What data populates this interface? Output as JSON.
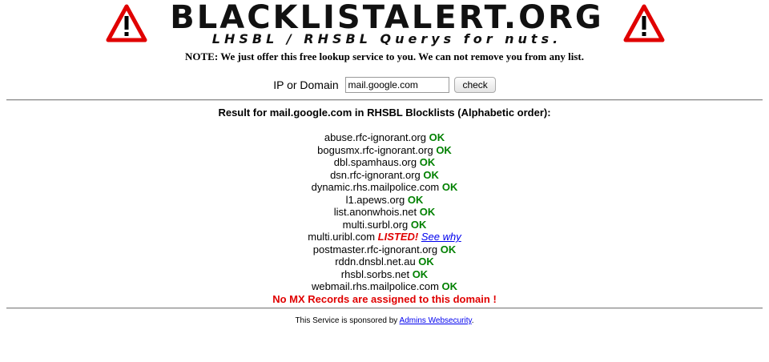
{
  "header": {
    "title": "BLACKLISTALERT.ORG",
    "subtitle": "LHSBL / RHSBL Querys for nuts.",
    "warning_icon": "warning-triangle-icon"
  },
  "note": "NOTE: We just offer this free lookup service to you. We can not remove you from any list.",
  "form": {
    "label": "IP or Domain",
    "input_value": "mail.google.com",
    "button_label": "check"
  },
  "result_title": "Result for mail.google.com in RHSBL Blocklists (Alphabetic order):",
  "results": [
    {
      "list": "abuse.rfc-ignorant.org",
      "status": "OK"
    },
    {
      "list": "bogusmx.rfc-ignorant.org",
      "status": "OK"
    },
    {
      "list": "dbl.spamhaus.org",
      "status": "OK"
    },
    {
      "list": "dsn.rfc-ignorant.org",
      "status": "OK"
    },
    {
      "list": "dynamic.rhs.mailpolice.com",
      "status": "OK"
    },
    {
      "list": "l1.apews.org",
      "status": "OK"
    },
    {
      "list": "list.anonwhois.net",
      "status": "OK"
    },
    {
      "list": "multi.surbl.org",
      "status": "OK"
    },
    {
      "list": "multi.uribl.com",
      "status": "LISTED!",
      "link": "See why"
    },
    {
      "list": "postmaster.rfc-ignorant.org",
      "status": "OK"
    },
    {
      "list": "rddn.dnsbl.net.au",
      "status": "OK"
    },
    {
      "list": "rhsbl.sorbs.net",
      "status": "OK"
    },
    {
      "list": "webmail.rhs.mailpolice.com",
      "status": "OK"
    }
  ],
  "no_mx": "No MX Records are assigned to this domain !",
  "sponsor": {
    "text": "This Service is sponsored by",
    "link": "Admins Websecurity",
    "suffix": "."
  },
  "colors": {
    "ok": "#008000",
    "listed": "#e00000",
    "link": "#0000ee",
    "warning_red": "#e00000"
  }
}
